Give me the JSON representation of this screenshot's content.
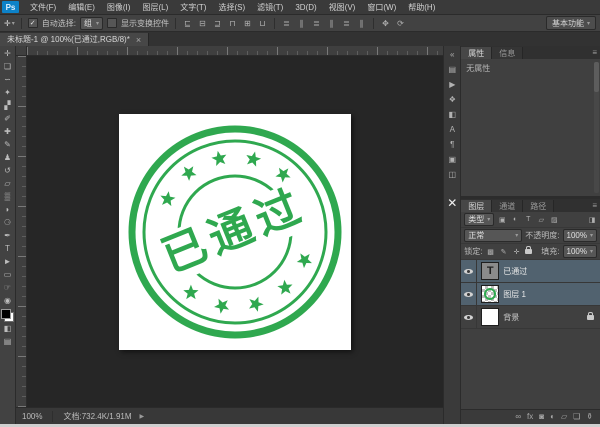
{
  "app": {
    "logo_text": "Ps"
  },
  "colors": {
    "stamp_green": "#2fa84f",
    "selection_blue": "#51626f",
    "foreground_color": "#000000",
    "background_color": "#ffffff"
  },
  "menubar": {
    "items": [
      "文件(F)",
      "编辑(E)",
      "图像(I)",
      "图层(L)",
      "文字(T)",
      "选择(S)",
      "滤镜(T)",
      "3D(D)",
      "视图(V)",
      "窗口(W)",
      "帮助(H)"
    ]
  },
  "options_bar": {
    "tool_icon": "✛",
    "caret": "▾",
    "auto_select_check": "✓",
    "auto_select_label": "自动选择:",
    "auto_select_value": "组",
    "show_transform_label": "显示变换控件",
    "align_icons": [
      "⊑",
      "⊟",
      "⊒",
      "⊓",
      "⊞",
      "⊔"
    ],
    "distribute_icons": [
      "≣",
      "∥",
      "≣",
      "∥",
      "≣",
      "∥"
    ],
    "extra_icons": [
      "✥",
      "⟳"
    ],
    "workspace_label": "基本功能"
  },
  "document_tab": {
    "title": "未标题-1 @ 100%(已通过,RGB/8)*",
    "close": "×"
  },
  "toolbar": {
    "tools": [
      {
        "name": "move-tool",
        "glyph": "✛"
      },
      {
        "name": "rectangular-marquee-tool",
        "glyph": "❏"
      },
      {
        "name": "lasso-tool",
        "glyph": "∽"
      },
      {
        "name": "quick-selection-tool",
        "glyph": "✦"
      },
      {
        "name": "crop-tool",
        "glyph": "▞"
      },
      {
        "name": "eyedropper-tool",
        "glyph": "✐"
      },
      {
        "name": "healing-brush-tool",
        "glyph": "✚"
      },
      {
        "name": "brush-tool",
        "glyph": "✎"
      },
      {
        "name": "clone-stamp-tool",
        "glyph": "♟"
      },
      {
        "name": "history-brush-tool",
        "glyph": "↺"
      },
      {
        "name": "eraser-tool",
        "glyph": "▱"
      },
      {
        "name": "gradient-tool",
        "glyph": "▒"
      },
      {
        "name": "blur-tool",
        "glyph": "◗"
      },
      {
        "name": "dodge-tool",
        "glyph": "⚆"
      },
      {
        "name": "pen-tool",
        "glyph": "✒"
      },
      {
        "name": "type-tool",
        "glyph": "T"
      },
      {
        "name": "path-selection-tool",
        "glyph": "►"
      },
      {
        "name": "shape-tool",
        "glyph": "▭"
      },
      {
        "name": "hand-tool",
        "glyph": "☞"
      },
      {
        "name": "zoom-tool",
        "glyph": "◉"
      }
    ],
    "quick_mask_icon": "◧",
    "screen_mode_icon": "▤"
  },
  "canvas": {
    "stamp_text": "已通过"
  },
  "dock": {
    "icons": [
      {
        "name": "collapse-dock",
        "glyph": "«"
      },
      {
        "name": "history-panel",
        "glyph": "▤"
      },
      {
        "name": "actions-panel",
        "glyph": "▶"
      },
      {
        "name": "styles-panel",
        "glyph": "❖"
      },
      {
        "name": "adjustments-panel",
        "glyph": "◧"
      },
      {
        "name": "character-panel",
        "glyph": "A"
      },
      {
        "name": "paragraph-panel",
        "glyph": "¶"
      },
      {
        "name": "clone-source-panel",
        "glyph": "▣"
      },
      {
        "name": "info-panel",
        "glyph": "◫"
      },
      {
        "name": "close-panel",
        "glyph": "✕"
      }
    ]
  },
  "properties_panel": {
    "tabs": [
      "属性",
      "信息"
    ],
    "panel_menu_icon": "≡",
    "empty_text": "无属性"
  },
  "layers_panel": {
    "tabs": [
      "图层",
      "通道",
      "路径"
    ],
    "panel_menu_icon": "≡",
    "filter_value": "类型",
    "filter_caret": "▾",
    "filter_icons": [
      "▣",
      "◐",
      "T",
      "▱",
      "▨"
    ],
    "filter_switch_icon": "◨",
    "blend_mode": "正常",
    "blend_caret": "▾",
    "opacity_label": "不透明度:",
    "opacity_value": "100%",
    "lock_label": "锁定:",
    "lock_icons": [
      "▩",
      "✎",
      "✛"
    ],
    "fill_label": "填充:",
    "fill_value": "100%",
    "layers": [
      {
        "name": "已通过",
        "type": "text",
        "thumb_label": "T",
        "selected": true
      },
      {
        "name": "图层 1",
        "type": "image",
        "selected": true
      },
      {
        "name": "背景",
        "type": "background",
        "locked": true
      }
    ],
    "footer_icons": [
      "∞",
      "fx",
      "◙",
      "◐",
      "▱",
      "❏",
      "⚱"
    ]
  },
  "status_bar": {
    "zoom": "100%",
    "doc_info": "文档:732.4K/1.91M",
    "arrow": "▶"
  }
}
